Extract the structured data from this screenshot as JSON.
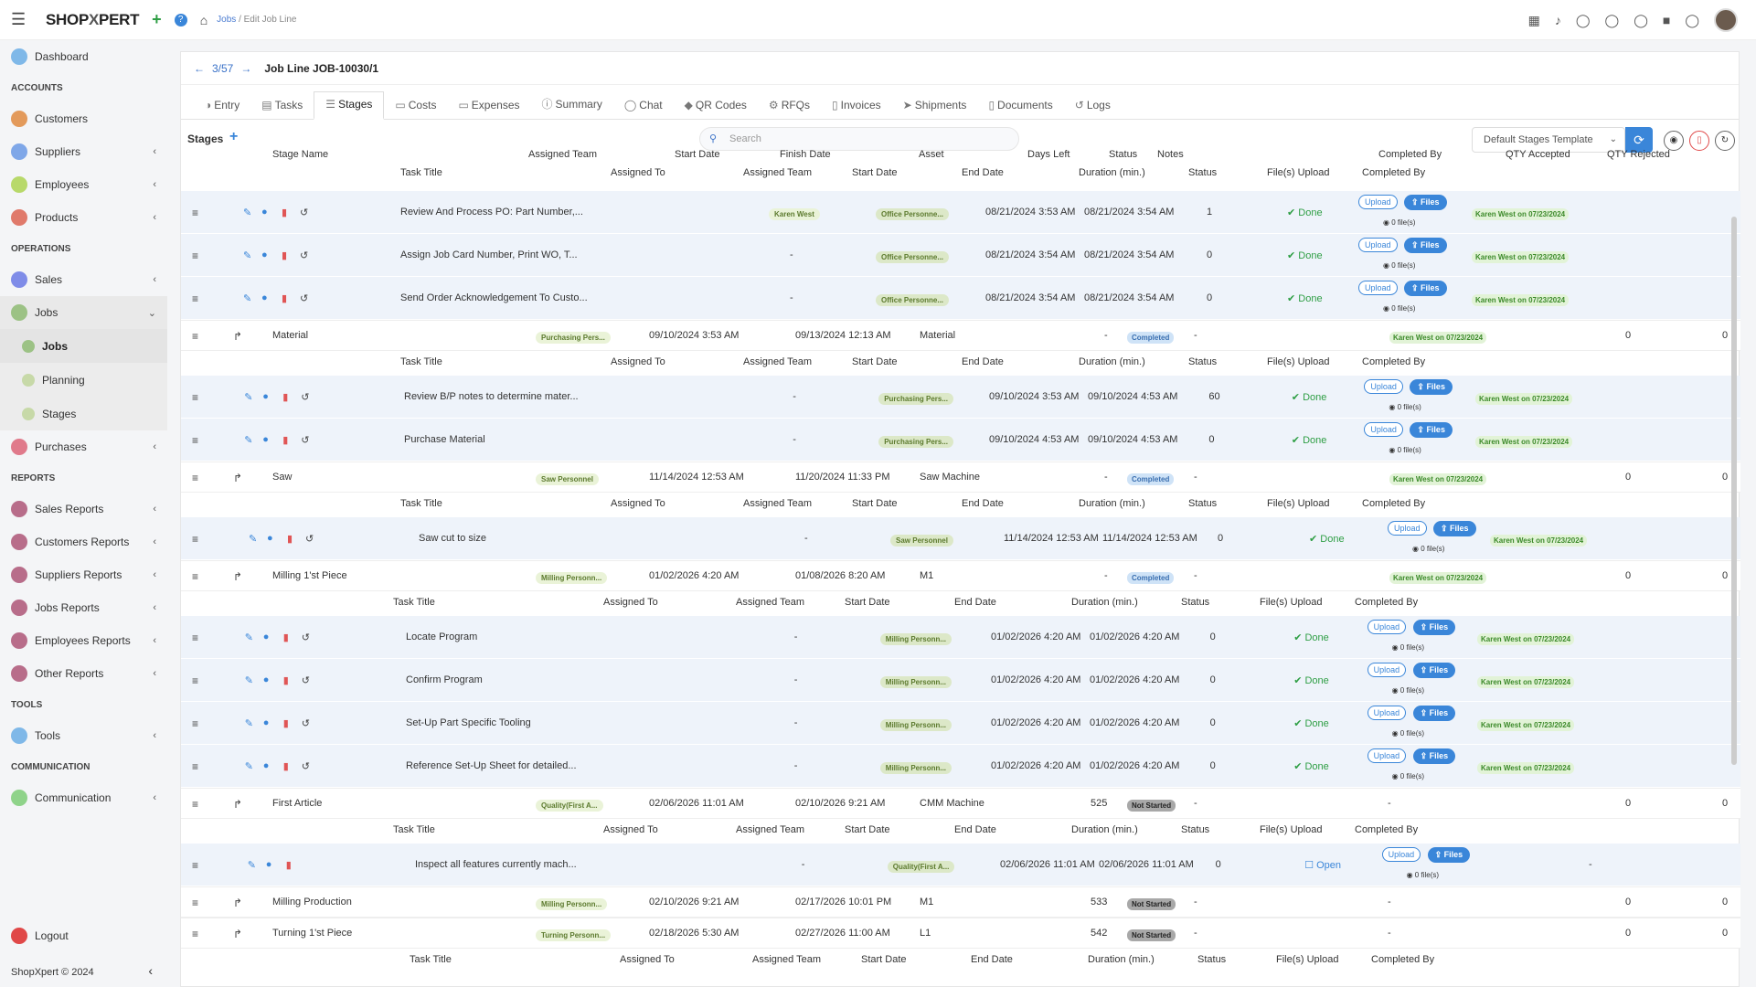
{
  "app": {
    "logo_left": "SHOP",
    "logo_x": "X",
    "logo_right": "PERT",
    "crumb_jobs": "Jobs",
    "crumb_sep": "/",
    "crumb_current": "Edit Job Line",
    "footer": "ShopXpert © 2024"
  },
  "sidebar": {
    "dashboard": "Dashboard",
    "accounts": "ACCOUNTS",
    "customers": "Customers",
    "suppliers": "Suppliers",
    "employees": "Employees",
    "products": "Products",
    "operations": "OPERATIONS",
    "sales": "Sales",
    "jobs": "Jobs",
    "jobs_sub": "Jobs",
    "planning": "Planning",
    "stages": "Stages",
    "purchases": "Purchases",
    "reports": "REPORTS",
    "sales_reports": "Sales Reports",
    "customers_reports": "Customers Reports",
    "suppliers_reports": "Suppliers Reports",
    "jobs_reports": "Jobs Reports",
    "employees_reports": "Employees Reports",
    "other_reports": "Other Reports",
    "tools_head": "TOOLS",
    "tools": "Tools",
    "comm_head": "COMMUNICATION",
    "communication": "Communication",
    "logout": "Logout"
  },
  "header": {
    "position": "3/57",
    "title": "Job Line JOB-10030/1"
  },
  "tabs": [
    "Entry",
    "Tasks",
    "Stages",
    "Costs",
    "Expenses",
    "Summary",
    "Chat",
    "QR Codes",
    "RFQs",
    "Invoices",
    "Shipments",
    "Documents",
    "Logs"
  ],
  "stages_label": "Stages",
  "search_placeholder": "Search",
  "template": "Default Stages Template",
  "stage_headers": [
    "Stage Name",
    "Assigned Team",
    "Start Date",
    "Finish Date",
    "Asset",
    "Days Left",
    "Status",
    "Notes",
    "Completed By",
    "QTY Accepted",
    "QTY Rejected"
  ],
  "task_headers": [
    "Task Title",
    "Assigned To",
    "Assigned Team",
    "Start Date",
    "End Date",
    "Duration (min.)",
    "Status",
    "File(s) Upload",
    "Completed By"
  ],
  "btn": {
    "upload": "Upload",
    "files": "Files",
    "file_count": "0 file(s)",
    "done": "Done",
    "open": "Open"
  },
  "rows": [
    {
      "t": "task",
      "title": "Review And Process PO: Part Number,...",
      "to": "Karen West",
      "team": "Office Personne...",
      "start": "08/21/2024 3:53 AM",
      "end": "08/21/2024 3:54 AM",
      "dur": "1",
      "status": "Done",
      "cby": "Karen West on 07/23/2024"
    },
    {
      "t": "task",
      "title": "Assign Job Card Number, Print WO, T...",
      "to": "-",
      "team": "Office Personne...",
      "start": "08/21/2024 3:54 AM",
      "end": "08/21/2024 3:54 AM",
      "dur": "0",
      "status": "Done",
      "cby": "Karen West on 07/23/2024"
    },
    {
      "t": "task",
      "title": "Send Order Acknowledgement To Custo...",
      "to": "-",
      "team": "Office Personne...",
      "start": "08/21/2024 3:54 AM",
      "end": "08/21/2024 3:54 AM",
      "dur": "0",
      "status": "Done",
      "cby": "Karen West on 07/23/2024"
    },
    {
      "t": "stage",
      "name": "Material",
      "team": "Purchasing Pers...",
      "start": "09/10/2024 3:53 AM",
      "finish": "09/13/2024 12:13 AM",
      "asset": "Material",
      "days": "-",
      "status": "Completed",
      "notes": "-",
      "cby": "Karen West on 07/23/2024",
      "acc": "0",
      "rej": "0"
    },
    {
      "t": "thead"
    },
    {
      "t": "task",
      "title": "Review B/P notes to determine mater...",
      "to": "-",
      "team": "Purchasing Pers...",
      "start": "09/10/2024 3:53 AM",
      "end": "09/10/2024 4:53 AM",
      "dur": "60",
      "status": "Done",
      "cby": "Karen West on 07/23/2024"
    },
    {
      "t": "task",
      "title": "Purchase Material",
      "to": "-",
      "team": "Purchasing Pers...",
      "start": "09/10/2024 4:53 AM",
      "end": "09/10/2024 4:53 AM",
      "dur": "0",
      "status": "Done",
      "cby": "Karen West on 07/23/2024"
    },
    {
      "t": "stage",
      "name": "Saw",
      "team": "Saw Personnel",
      "start": "11/14/2024 12:53 AM",
      "finish": "11/20/2024 11:33 PM",
      "asset": "Saw Machine",
      "days": "-",
      "status": "Completed",
      "notes": "-",
      "cby": "Karen West on 07/23/2024",
      "acc": "0",
      "rej": "0"
    },
    {
      "t": "thead"
    },
    {
      "t": "task",
      "title": "Saw cut to size",
      "to": "-",
      "team": "Saw Personnel",
      "start": "11/14/2024 12:53 AM",
      "end": "11/14/2024 12:53 AM",
      "dur": "0",
      "status": "Done",
      "cby": "Karen West on 07/23/2024"
    },
    {
      "t": "stage",
      "name": "Milling 1'st Piece",
      "team": "Milling Personn...",
      "start": "01/02/2026 4:20 AM",
      "finish": "01/08/2026 8:20 AM",
      "asset": "M1",
      "days": "-",
      "status": "Completed",
      "notes": "-",
      "cby": "Karen West on 07/23/2024",
      "acc": "0",
      "rej": "0"
    },
    {
      "t": "thead"
    },
    {
      "t": "task",
      "title": "Locate Program",
      "to": "-",
      "team": "Milling Personn...",
      "start": "01/02/2026 4:20 AM",
      "end": "01/02/2026 4:20 AM",
      "dur": "0",
      "status": "Done",
      "cby": "Karen West on 07/23/2024"
    },
    {
      "t": "task",
      "title": "Confirm Program",
      "to": "-",
      "team": "Milling Personn...",
      "start": "01/02/2026 4:20 AM",
      "end": "01/02/2026 4:20 AM",
      "dur": "0",
      "status": "Done",
      "cby": "Karen West on 07/23/2024"
    },
    {
      "t": "task",
      "title": "Set-Up Part Specific Tooling",
      "to": "-",
      "team": "Milling Personn...",
      "start": "01/02/2026 4:20 AM",
      "end": "01/02/2026 4:20 AM",
      "dur": "0",
      "status": "Done",
      "cby": "Karen West on 07/23/2024"
    },
    {
      "t": "task",
      "title": "Reference Set-Up Sheet for detailed...",
      "to": "-",
      "team": "Milling Personn...",
      "start": "01/02/2026 4:20 AM",
      "end": "01/02/2026 4:20 AM",
      "dur": "0",
      "status": "Done",
      "cby": "Karen West on 07/23/2024"
    },
    {
      "t": "stage",
      "name": "First Article",
      "team": "Quality(First A...",
      "start": "02/06/2026 11:01 AM",
      "finish": "02/10/2026 9:21 AM",
      "asset": "CMM Machine",
      "days": "525",
      "status": "Not Started",
      "notes": "-",
      "cby": "-",
      "acc": "0",
      "rej": "0"
    },
    {
      "t": "thead"
    },
    {
      "t": "task",
      "title": "Inspect all features currently mach...",
      "to": "-",
      "team": "Quality(First A...",
      "start": "02/06/2026 11:01 AM",
      "end": "02/06/2026 11:01 AM",
      "dur": "0",
      "status": "Open",
      "cby": "-"
    },
    {
      "t": "stage",
      "name": "Milling Production",
      "team": "Milling Personn...",
      "start": "02/10/2026 9:21 AM",
      "finish": "02/17/2026 10:01 PM",
      "asset": "M1",
      "days": "533",
      "status": "Not Started",
      "notes": "-",
      "cby": "-",
      "acc": "0",
      "rej": "0"
    },
    {
      "t": "stage",
      "name": "Turning 1'st Piece",
      "team": "Turning Personn...",
      "start": "02/18/2026 5:30 AM",
      "finish": "02/27/2026 11:00 AM",
      "asset": "L1",
      "days": "542",
      "status": "Not Started",
      "notes": "-",
      "cby": "-",
      "acc": "0",
      "rej": "0"
    },
    {
      "t": "thead"
    }
  ]
}
